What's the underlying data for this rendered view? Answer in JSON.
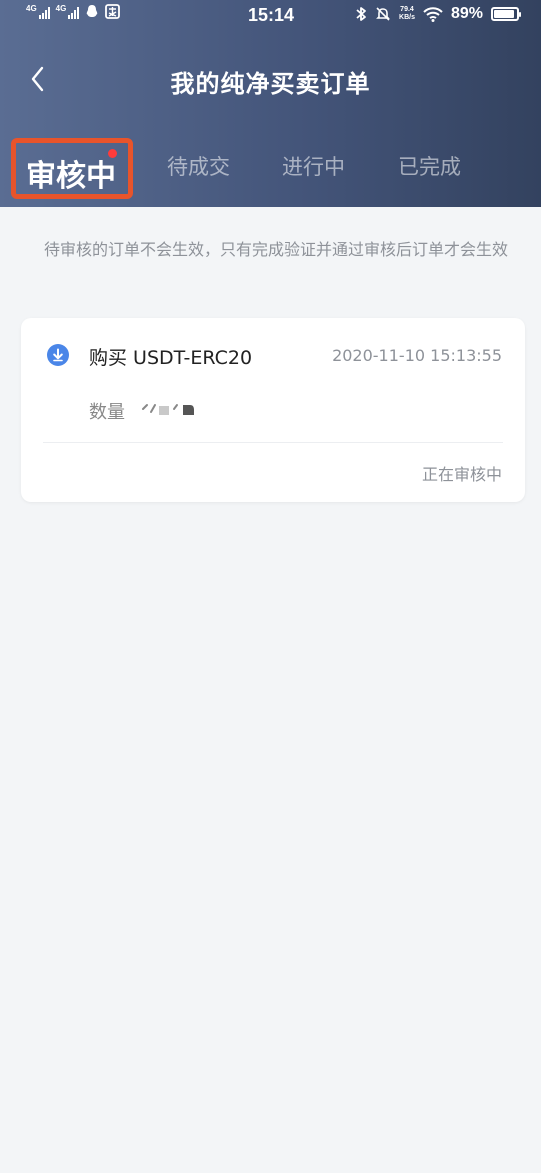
{
  "status_bar": {
    "signal1_label": "4G",
    "signal2_label": "4G",
    "time": "15:14",
    "net_speed_value": "79.4",
    "net_speed_unit": "KB/s",
    "battery_percent": "89%",
    "battery_level": 0.89
  },
  "header": {
    "title": "我的纯净买卖订单"
  },
  "tabs": [
    {
      "label": "审核中",
      "active": true,
      "has_dot": true
    },
    {
      "label": "待成交",
      "active": false
    },
    {
      "label": "进行中",
      "active": false
    },
    {
      "label": "已完成",
      "active": false
    }
  ],
  "notice": "待审核的订单不会生效，只有完成验证并通过审核后订单才会生效",
  "orders": [
    {
      "type": "购买 USDT-ERC20",
      "datetime": "2020-11-10 15:13:55",
      "quantity_label": "数量",
      "status": "正在审核中"
    }
  ],
  "colors": {
    "header_gradient_start": "#5a6d93",
    "header_gradient_end": "#33425f",
    "highlight_border": "#e8542b",
    "badge_dot": "#ff3b3b",
    "download_icon": "#4a86e8",
    "background": "#f3f5f7"
  },
  "icons": {
    "back": "chevron-left-icon",
    "order_type": "download-icon",
    "bluetooth": "bluetooth-icon",
    "mute": "bell-off-icon",
    "wifi": "wifi-icon",
    "battery": "battery-icon"
  }
}
